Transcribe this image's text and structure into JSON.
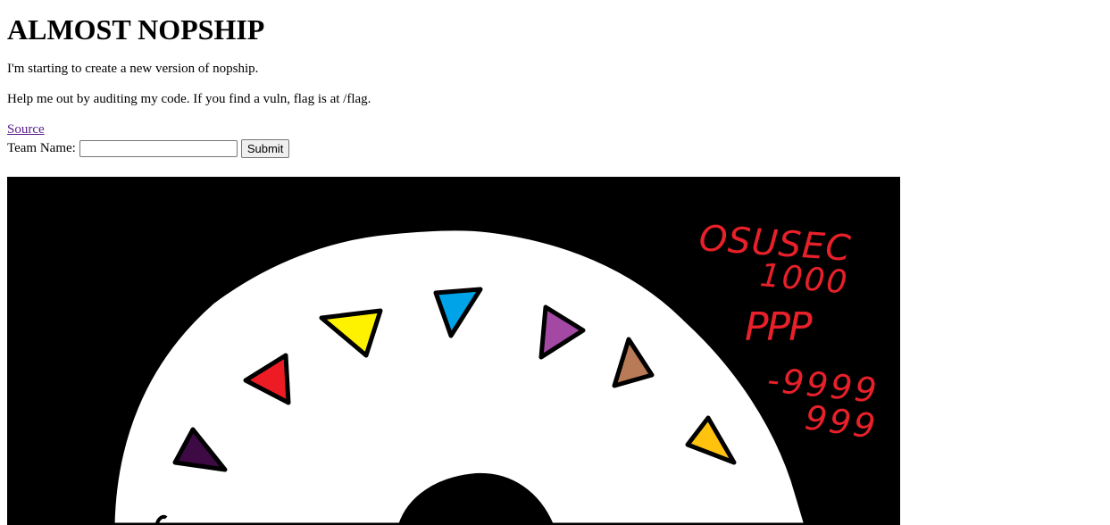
{
  "page": {
    "title": "ALMOST NOPSHIP",
    "paragraphs": [
      "I'm starting to create a new version of nopship.",
      "Help me out by auditing my code. If you find a vuln, flag is at /flag."
    ],
    "source_link_label": "Source",
    "form": {
      "team_name_label": "Team Name:",
      "team_name_value": "",
      "team_name_placeholder": "",
      "submit_label": "Submit"
    }
  },
  "drawing": {
    "scribbles": [
      "OSUSEC",
      "1000",
      "PPP",
      "-9999",
      "999"
    ],
    "colors": {
      "background": "#000000",
      "wheel": "#ffffff",
      "scribble": "#e8202a",
      "link_visited": "#551a8b"
    },
    "markers": [
      {
        "name": "dark-purple-triangle",
        "color": "#3d0a44"
      },
      {
        "name": "red-triangle",
        "color": "#ed1c24"
      },
      {
        "name": "yellow-triangle",
        "color": "#fff200"
      },
      {
        "name": "blue-triangle",
        "color": "#00a2e8"
      },
      {
        "name": "purple-triangle",
        "color": "#a349a4"
      },
      {
        "name": "brown-triangle",
        "color": "#b97a57"
      },
      {
        "name": "orange-triangle",
        "color": "#ffc20e"
      }
    ]
  }
}
